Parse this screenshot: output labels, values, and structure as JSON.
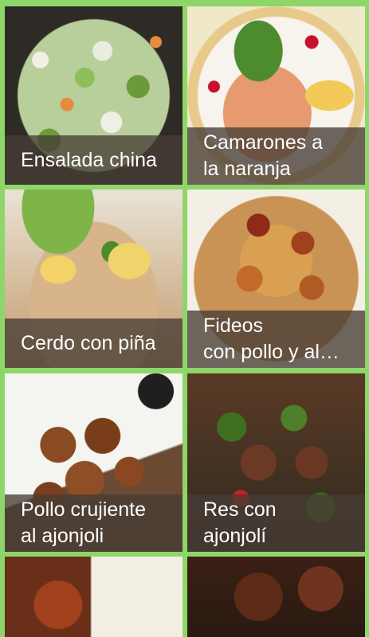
{
  "recipes": [
    {
      "title": "Ensalada china"
    },
    {
      "title": "Camarones a\nla naranja"
    },
    {
      "title": "Cerdo con piña"
    },
    {
      "title": "Fideos\ncon pollo y al…"
    },
    {
      "title": "Pollo crujiente\nal ajonjoli"
    },
    {
      "title": "Res con\najonjolí"
    },
    {
      "title": ""
    },
    {
      "title": ""
    }
  ],
  "colors": {
    "background": "#8ed66a",
    "caption_overlay": "#463c34"
  }
}
